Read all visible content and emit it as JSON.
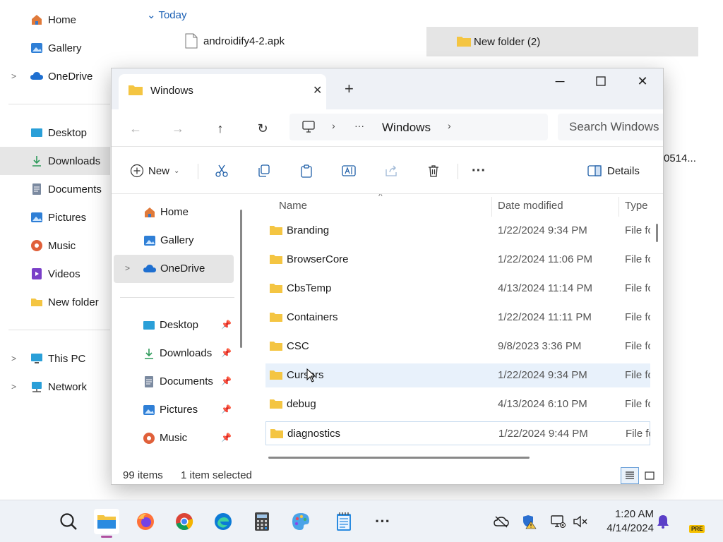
{
  "background": {
    "nav_items": [
      {
        "label": "Home",
        "icon": "home-icon",
        "chevron": false
      },
      {
        "label": "Gallery",
        "icon": "gallery-icon",
        "chevron": false
      },
      {
        "label": "OneDrive",
        "icon": "cloud-icon",
        "chevron": true
      },
      {
        "label": "Desktop",
        "icon": "desktop-icon",
        "chevron": false
      },
      {
        "label": "Downloads",
        "icon": "download-icon",
        "chevron": false,
        "selected": true
      },
      {
        "label": "Documents",
        "icon": "documents-icon",
        "chevron": false
      },
      {
        "label": "Pictures",
        "icon": "pictures-icon",
        "chevron": false
      },
      {
        "label": "Music",
        "icon": "music-icon",
        "chevron": false
      },
      {
        "label": "Videos",
        "icon": "videos-icon",
        "chevron": false
      },
      {
        "label": "New folder",
        "icon": "folder-icon",
        "chevron": false
      },
      {
        "label": "This PC",
        "icon": "computer-icon",
        "chevron": true
      },
      {
        "label": "Network",
        "icon": "network-icon",
        "chevron": true
      }
    ],
    "group_label": "Today",
    "file_name": "androidify4-2.apk",
    "selected_folder": "New folder (2)",
    "truncated_text": "0514..."
  },
  "window": {
    "tab_title": "Windows",
    "new_tab": "+",
    "breadcrumb": {
      "more": "···",
      "current": "Windows"
    },
    "search_placeholder": "Search Windows",
    "toolbar": {
      "new_label": "New",
      "details_label": "Details"
    },
    "sidebar": [
      {
        "label": "Home",
        "icon": "home-icon",
        "pinned": false
      },
      {
        "label": "Gallery",
        "icon": "gallery-icon",
        "pinned": false
      },
      {
        "label": "OneDrive",
        "icon": "cloud-icon",
        "pinned": false,
        "chevron": true,
        "selected": true
      },
      {
        "label": "Desktop",
        "icon": "desktop-icon",
        "pinned": true
      },
      {
        "label": "Downloads",
        "icon": "download-icon",
        "pinned": true
      },
      {
        "label": "Documents",
        "icon": "documents-icon",
        "pinned": true
      },
      {
        "label": "Pictures",
        "icon": "pictures-icon",
        "pinned": true
      },
      {
        "label": "Music",
        "icon": "music-icon",
        "pinned": true
      }
    ],
    "columns": {
      "name": "Name",
      "date": "Date modified",
      "type": "Type"
    },
    "rows": [
      {
        "name": "Branding",
        "date": "1/22/2024 9:34 PM",
        "type": "File fo"
      },
      {
        "name": "BrowserCore",
        "date": "1/22/2024 11:06 PM",
        "type": "File fo"
      },
      {
        "name": "CbsTemp",
        "date": "4/13/2024 11:14 PM",
        "type": "File fo"
      },
      {
        "name": "Containers",
        "date": "1/22/2024 11:11 PM",
        "type": "File fo"
      },
      {
        "name": "CSC",
        "date": "9/8/2023 3:36 PM",
        "type": "File fo"
      },
      {
        "name": "Cursors",
        "date": "1/22/2024 9:34 PM",
        "type": "File fo",
        "hover": true
      },
      {
        "name": "debug",
        "date": "4/13/2024 6:10 PM",
        "type": "File fo"
      },
      {
        "name": "diagnostics",
        "date": "1/22/2024 9:44 PM",
        "type": "File fo",
        "focused": true
      }
    ],
    "status": {
      "count": "99 items",
      "selection": "1 item selected"
    }
  },
  "taskbar": {
    "apps": [
      "search-icon",
      "file-explorer-icon",
      "firefox-icon",
      "chrome-icon",
      "edge-icon",
      "calculator-icon",
      "paint-icon",
      "notepad-icon",
      "more-apps-icon"
    ],
    "time": "1:20 AM",
    "date": "4/14/2024",
    "badge": "PRE"
  },
  "colors": {
    "accent": "#1f5fa8",
    "folder": "#f4c542",
    "selection": "#e5e5e5"
  }
}
